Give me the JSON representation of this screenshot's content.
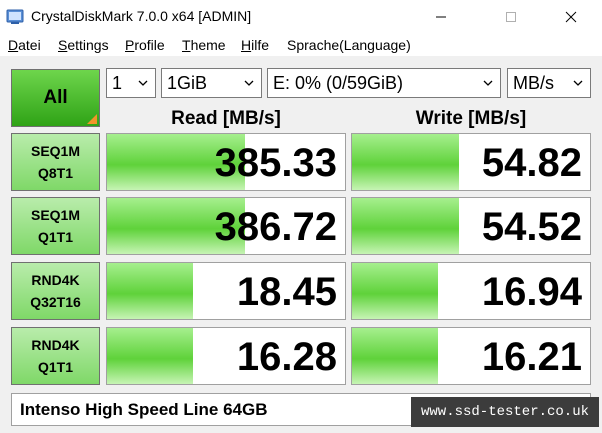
{
  "window": {
    "title": "CrystalDiskMark 7.0.0 x64 [ADMIN]"
  },
  "menu": [
    {
      "label": "Datei",
      "underline": "D",
      "rest": "atei"
    },
    {
      "label": "Settings",
      "underline": "S",
      "rest": "ettings"
    },
    {
      "label": "Profile",
      "underline": "P",
      "rest": "rofile"
    },
    {
      "label": "Theme",
      "underline": "T",
      "rest": "heme"
    },
    {
      "label": "Hilfe",
      "underline": "H",
      "rest": "ilfe"
    },
    {
      "label": "Sprache(Language)",
      "underline": "",
      "rest": "Sprache(Language)"
    }
  ],
  "controls": {
    "all_label": "All",
    "count": "1",
    "size": "1GiB",
    "drive": "E: 0% (0/59GiB)",
    "unit": "MB/s"
  },
  "headers": {
    "read": "Read [MB/s]",
    "write": "Write [MB/s]"
  },
  "rows": [
    {
      "line1": "SEQ1M",
      "line2": "Q8T1",
      "read": "385.33",
      "write": "54.82",
      "read_fill": 0.58,
      "write_fill": 0.45
    },
    {
      "line1": "SEQ1M",
      "line2": "Q1T1",
      "read": "386.72",
      "write": "54.52",
      "read_fill": 0.58,
      "write_fill": 0.45
    },
    {
      "line1": "RND4K",
      "line2": "Q32T16",
      "read": "18.45",
      "write": "16.94",
      "read_fill": 0.36,
      "write_fill": 0.36
    },
    {
      "line1": "RND4K",
      "line2": "Q1T1",
      "read": "16.28",
      "write": "16.21",
      "read_fill": 0.36,
      "write_fill": 0.36
    }
  ],
  "device": "Intenso High Speed Line 64GB",
  "watermark": "www.ssd-tester.co.uk",
  "colors": {
    "accent_green": "#2fa316",
    "label_green": "#7fd868",
    "bar_green": "#5fd23a",
    "corner_orange": "#f29429"
  }
}
